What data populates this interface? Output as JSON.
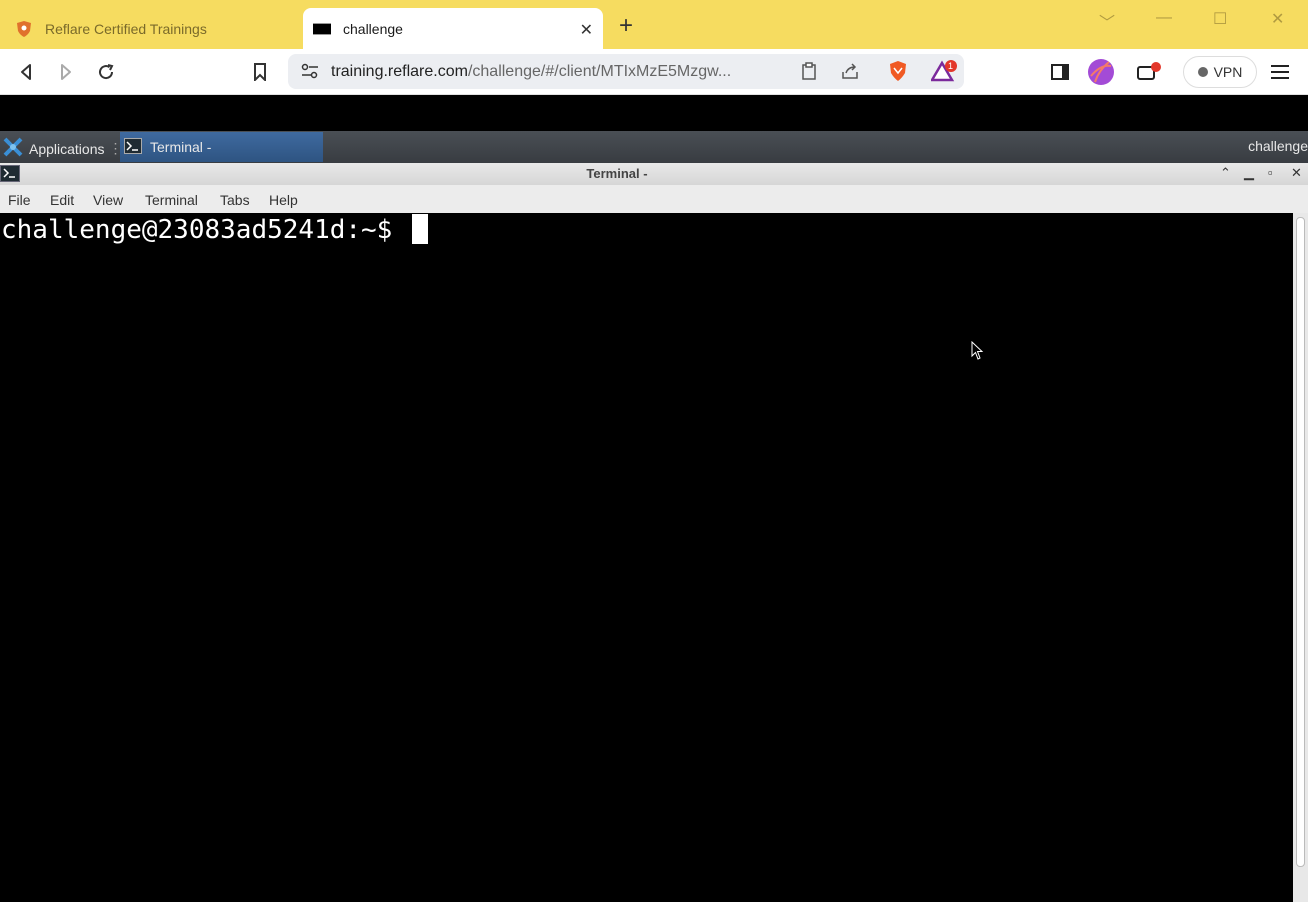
{
  "browser": {
    "tabs": [
      {
        "label": "Reflare Certified Trainings",
        "active": false
      },
      {
        "label": "challenge",
        "active": true
      }
    ],
    "url": {
      "host": "training.reflare.com",
      "path": "/challenge/#/client/MTIxMzE5Mzgw..."
    },
    "alerts_badge": "1",
    "vpn_label": "VPN"
  },
  "desktop": {
    "applications_label": "Applications",
    "task_label": "Terminal -",
    "panel_right_label": "challenge"
  },
  "terminal_window": {
    "title": "Terminal -",
    "menu": [
      "File",
      "Edit",
      "View",
      "Terminal",
      "Tabs",
      "Help"
    ],
    "prompt": "challenge@23083ad5241d:~$ "
  }
}
